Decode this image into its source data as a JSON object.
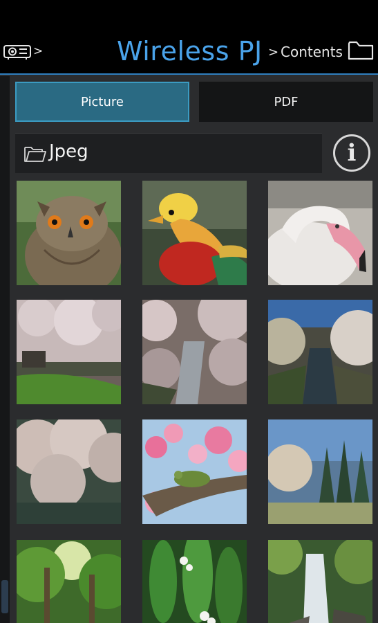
{
  "header": {
    "title": "Wireless PJ",
    "crumb_sep": ">",
    "crumb_current": "Contents",
    "icons": [
      "projector-icon",
      "folder-icon"
    ]
  },
  "tabs": [
    {
      "label": "Picture",
      "selected": true
    },
    {
      "label": "PDF",
      "selected": false
    }
  ],
  "folder": {
    "name": "Jpeg",
    "icons": [
      "folder-open-icon",
      "info-icon"
    ]
  },
  "thumbnails": [
    {
      "subject": "owl"
    },
    {
      "subject": "golden pheasant"
    },
    {
      "subject": "flamingo"
    },
    {
      "subject": "cherry blossom garden"
    },
    {
      "subject": "cherry blossom stream"
    },
    {
      "subject": "canal with blossoms"
    },
    {
      "subject": "blossom tree"
    },
    {
      "subject": "bird on branch with pink blossoms"
    },
    {
      "subject": "blossom tree by forest"
    },
    {
      "subject": "forest canopy"
    },
    {
      "subject": "lily of the valley"
    },
    {
      "subject": "waterfall"
    }
  ],
  "colors": {
    "accent": "#4aa3ea",
    "tab_selected": "#2a6a83",
    "header_bg": "#000000",
    "page_bg": "#2b2c2e"
  }
}
